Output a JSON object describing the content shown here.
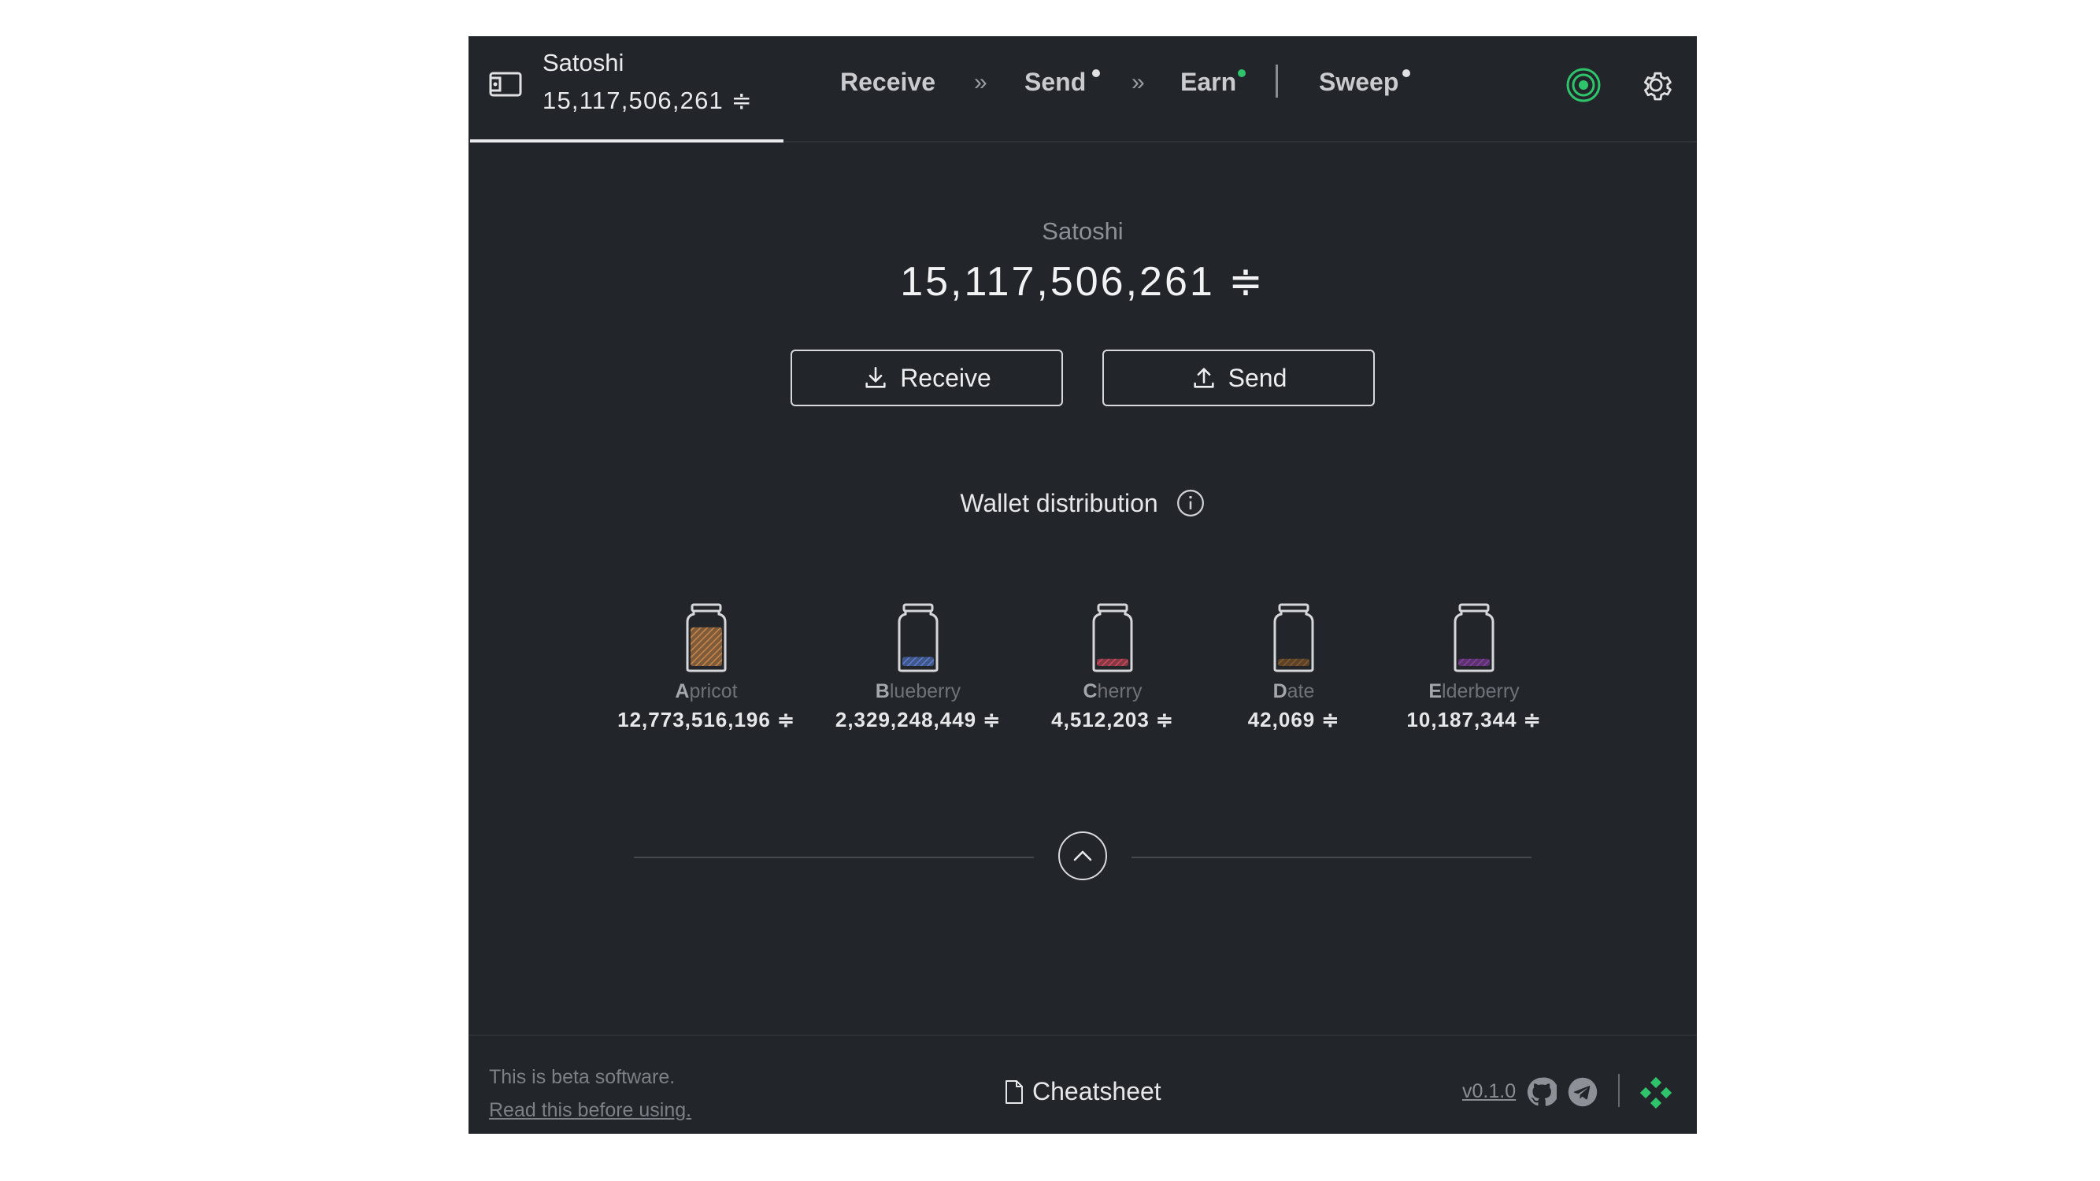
{
  "colors": {
    "background": "#222529",
    "text": "#e9eaec",
    "accent_green": "#2fc46b",
    "apricot": "#c9874a",
    "blueberry": "#5a7fd6",
    "cherry": "#d4495a",
    "date": "#8a5a2b",
    "elderberry": "#8a3fa6"
  },
  "header": {
    "wallet_name": "Satoshi",
    "wallet_balance": "15,117,506,261 ≑",
    "nav": {
      "receive": "Receive",
      "sep1": "»",
      "send": "Send",
      "sep2": "»",
      "earn": "Earn",
      "sweep": "Sweep"
    },
    "icons": [
      "wallet-icon",
      "tor-status-icon",
      "gear-icon"
    ]
  },
  "main": {
    "wallet_title": "Satoshi",
    "balance": "15,117,506,261 ≑",
    "receive_button": "Receive",
    "send_button": "Send",
    "distribution_title": "Wallet distribution"
  },
  "jars": [
    {
      "initial": "A",
      "rest": "pricot",
      "amount": "12,773,516,196 ≑",
      "color": "#c9874a",
      "fill_fraction": 0.85
    },
    {
      "initial": "B",
      "rest": "lueberry",
      "amount": "2,329,248,449 ≑",
      "color": "#5a7fd6",
      "fill_fraction": 0.2
    },
    {
      "initial": "C",
      "rest": "herry",
      "amount": "4,512,203 ≑",
      "color": "#d4495a",
      "fill_fraction": 0.16
    },
    {
      "initial": "D",
      "rest": "ate",
      "amount": "42,069 ≑",
      "color": "#8a5a2b",
      "fill_fraction": 0.16
    },
    {
      "initial": "E",
      "rest": "lderberry",
      "amount": "10,187,344 ≑",
      "color": "#8a3fa6",
      "fill_fraction": 0.16
    }
  ],
  "footer": {
    "beta_text": "This is beta software.",
    "read_link": "Read this before using.",
    "cheatsheet": "Cheatsheet",
    "version": "v0.1.0"
  }
}
